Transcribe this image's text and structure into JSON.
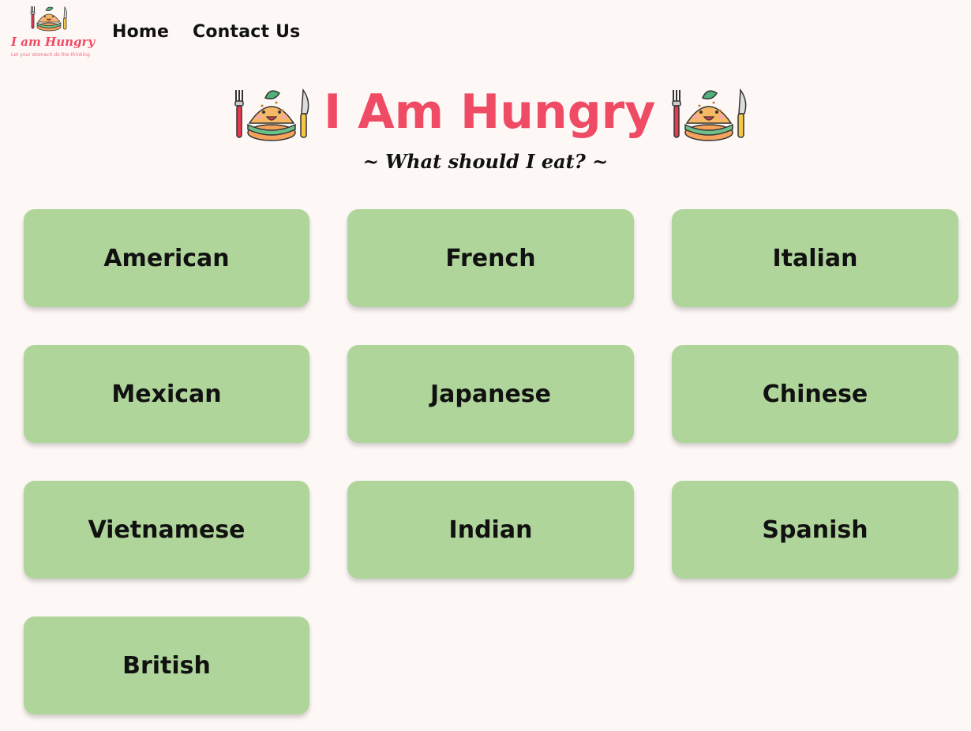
{
  "nav": {
    "logo": {
      "title": "I am Hungry",
      "tagline": "Let your stomach do the thinking",
      "icon": "hungry-burger-icon"
    },
    "links": [
      {
        "label": "Home"
      },
      {
        "label": "Contact Us"
      }
    ]
  },
  "hero": {
    "title": "I Am Hungry",
    "subtitle": "~ What should I eat? ~",
    "icon": "burger-with-cutlery-icon"
  },
  "cuisines": [
    {
      "label": "American"
    },
    {
      "label": "French"
    },
    {
      "label": "Italian"
    },
    {
      "label": "Mexican"
    },
    {
      "label": "Japanese"
    },
    {
      "label": "Chinese"
    },
    {
      "label": "Vietnamese"
    },
    {
      "label": "Indian"
    },
    {
      "label": "Spanish"
    },
    {
      "label": "British"
    }
  ],
  "colors": {
    "background": "#fdf8f6",
    "accent": "#f04b64",
    "button": "#afd59a",
    "text": "#111111"
  }
}
